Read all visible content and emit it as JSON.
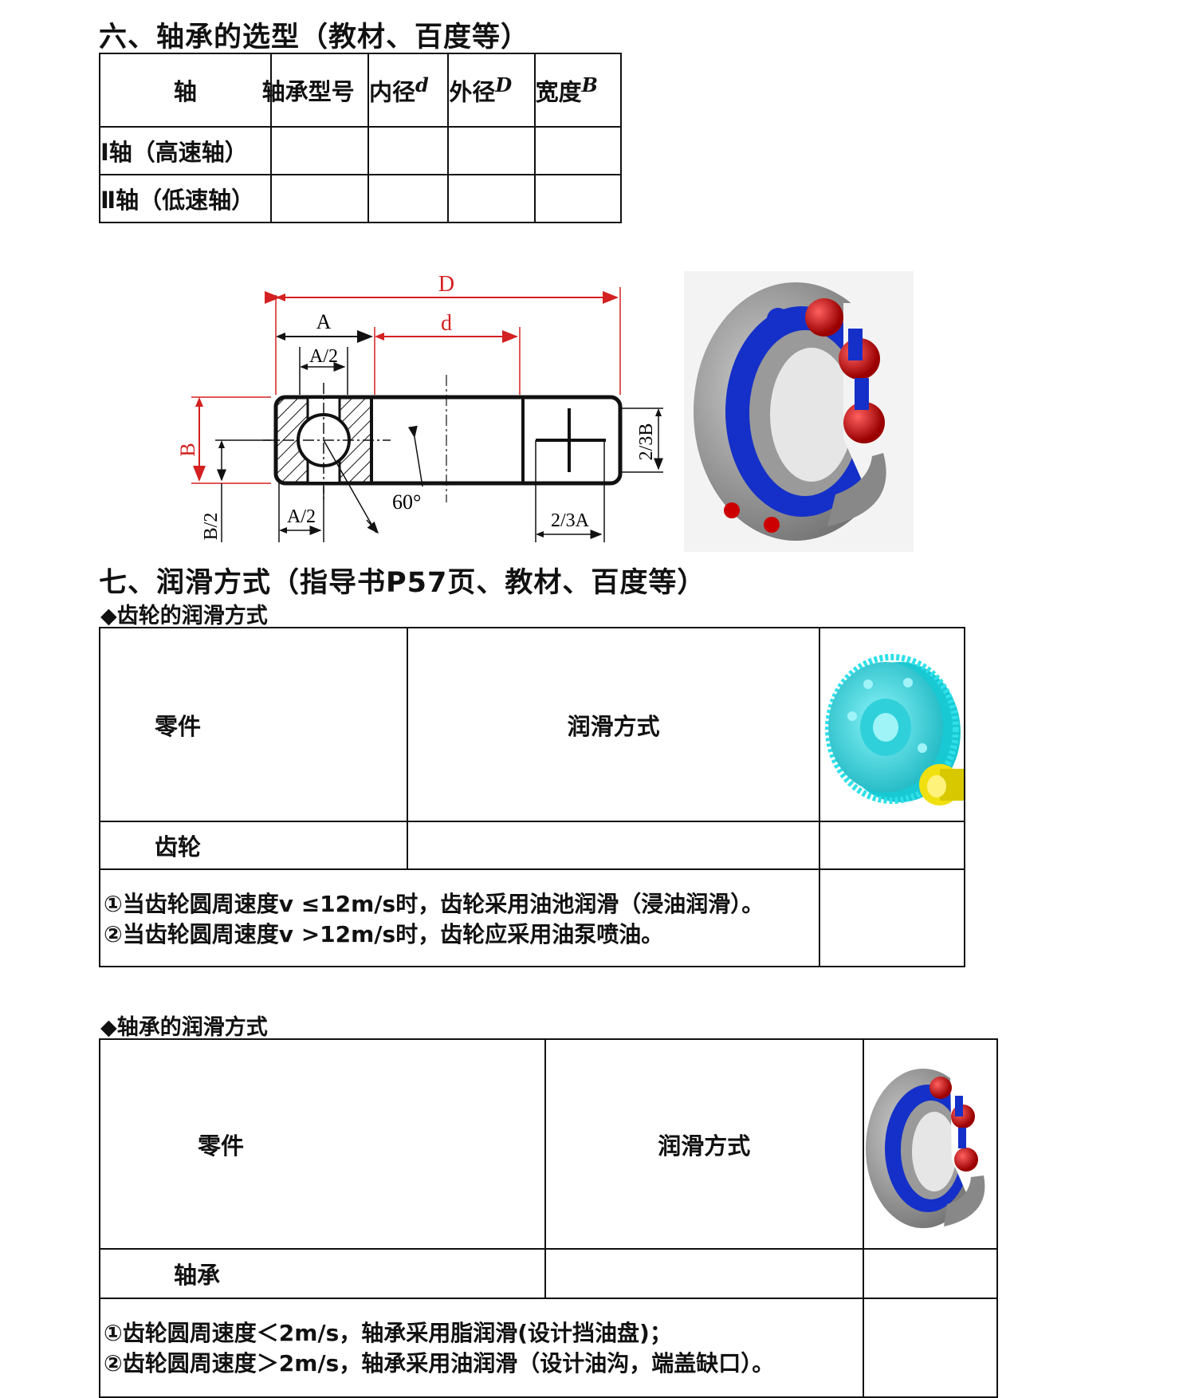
{
  "section6": {
    "title": "六、轴承的选型（教材、百度等）",
    "table": {
      "headers": [
        "轴",
        "轴承型号",
        "内径",
        "外径",
        "宽度"
      ],
      "header_symbols": [
        "",
        "",
        "d",
        "D",
        "B"
      ],
      "rows": [
        {
          "label": "Ⅰ轴（高速轴）",
          "cells": [
            "",
            "",
            "",
            ""
          ]
        },
        {
          "label": "Ⅱ轴（低速轴）",
          "cells": [
            "",
            "",
            "",
            ""
          ]
        }
      ]
    },
    "diagram": {
      "labels": {
        "outer_diameter": "D",
        "inner_diameter": "d",
        "width_a": "A",
        "half_a_top": "A/2",
        "half_a_bottom": "A/2",
        "height_b": "B",
        "half_b": "B/2",
        "two_thirds_b": "2/3B",
        "two_thirds_a": "2/3A",
        "angle": "60°"
      },
      "colors": {
        "dimension_red": "#d42020",
        "line": "#111111"
      }
    },
    "bearing_image": {
      "icon": "ball-bearing-render",
      "colors": {
        "ring": "#8c8c8c",
        "cage": "#1530c8",
        "balls": "#d01010"
      }
    }
  },
  "section7": {
    "title": "七、润滑方式（指导书P57页、教材、百度等）",
    "gear": {
      "subtitle": "◆齿轮的润滑方式",
      "header_part": "零件",
      "header_method": "润滑方式",
      "row_part": "齿轮",
      "row_method": "",
      "notes": [
        "①当齿轮圆周速度v ≤12m/s时，齿轮采用油池润滑（浸油润滑）。",
        "②当齿轮圆周速度v >12m/s时，齿轮应采用油泵喷油。"
      ],
      "image": {
        "icon": "gear-render",
        "colors": {
          "gear": "#2fe0e8",
          "pinion": "#f0e010"
        }
      }
    },
    "bearing": {
      "subtitle": "◆轴承的润滑方式",
      "header_part": "零件",
      "header_method": "润滑方式",
      "row_part": "轴承",
      "row_method": "",
      "notes": [
        "①齿轮圆周速度＜2m/s，轴承采用脂润滑(设计挡油盘)；",
        "②齿轮圆周速度＞2m/s，轴承采用油润滑（设计油沟，端盖缺口）。"
      ],
      "image": {
        "icon": "ball-bearing-render"
      }
    }
  }
}
